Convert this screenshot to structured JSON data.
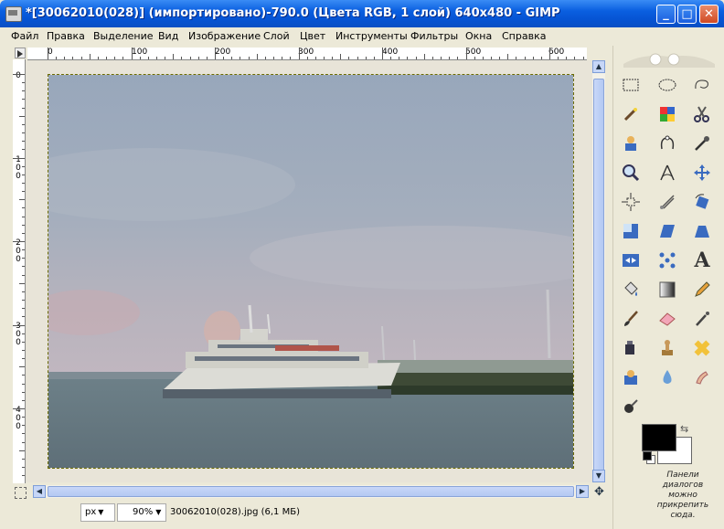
{
  "window": {
    "title": "*[30062010(028)] (импортировано)-790.0 (Цвета RGB, 1 слой) 640x480 - GIMP",
    "minimize": "_",
    "maximize": "□",
    "close": "✕"
  },
  "menu": {
    "items": [
      "Файл",
      "Правка",
      "Выделение",
      "Вид",
      "Изображение",
      "Слой",
      "Цвет",
      "Инструменты",
      "Фильтры",
      "Окна",
      "Справка"
    ]
  },
  "ruler": {
    "h_labels": [
      "0",
      "100",
      "200",
      "300",
      "400",
      "500",
      "600"
    ],
    "v_labels": [
      "0",
      "100",
      "200",
      "300",
      "400"
    ]
  },
  "status": {
    "unit": "px",
    "zoom": "90%",
    "info": "30062010(028).jpg (6,1 МБ)"
  },
  "toolbox": {
    "dock_note": "Панели диалогов можно прикрепить сюда.",
    "fg_color": "#000000",
    "bg_color": "#ffffff"
  }
}
